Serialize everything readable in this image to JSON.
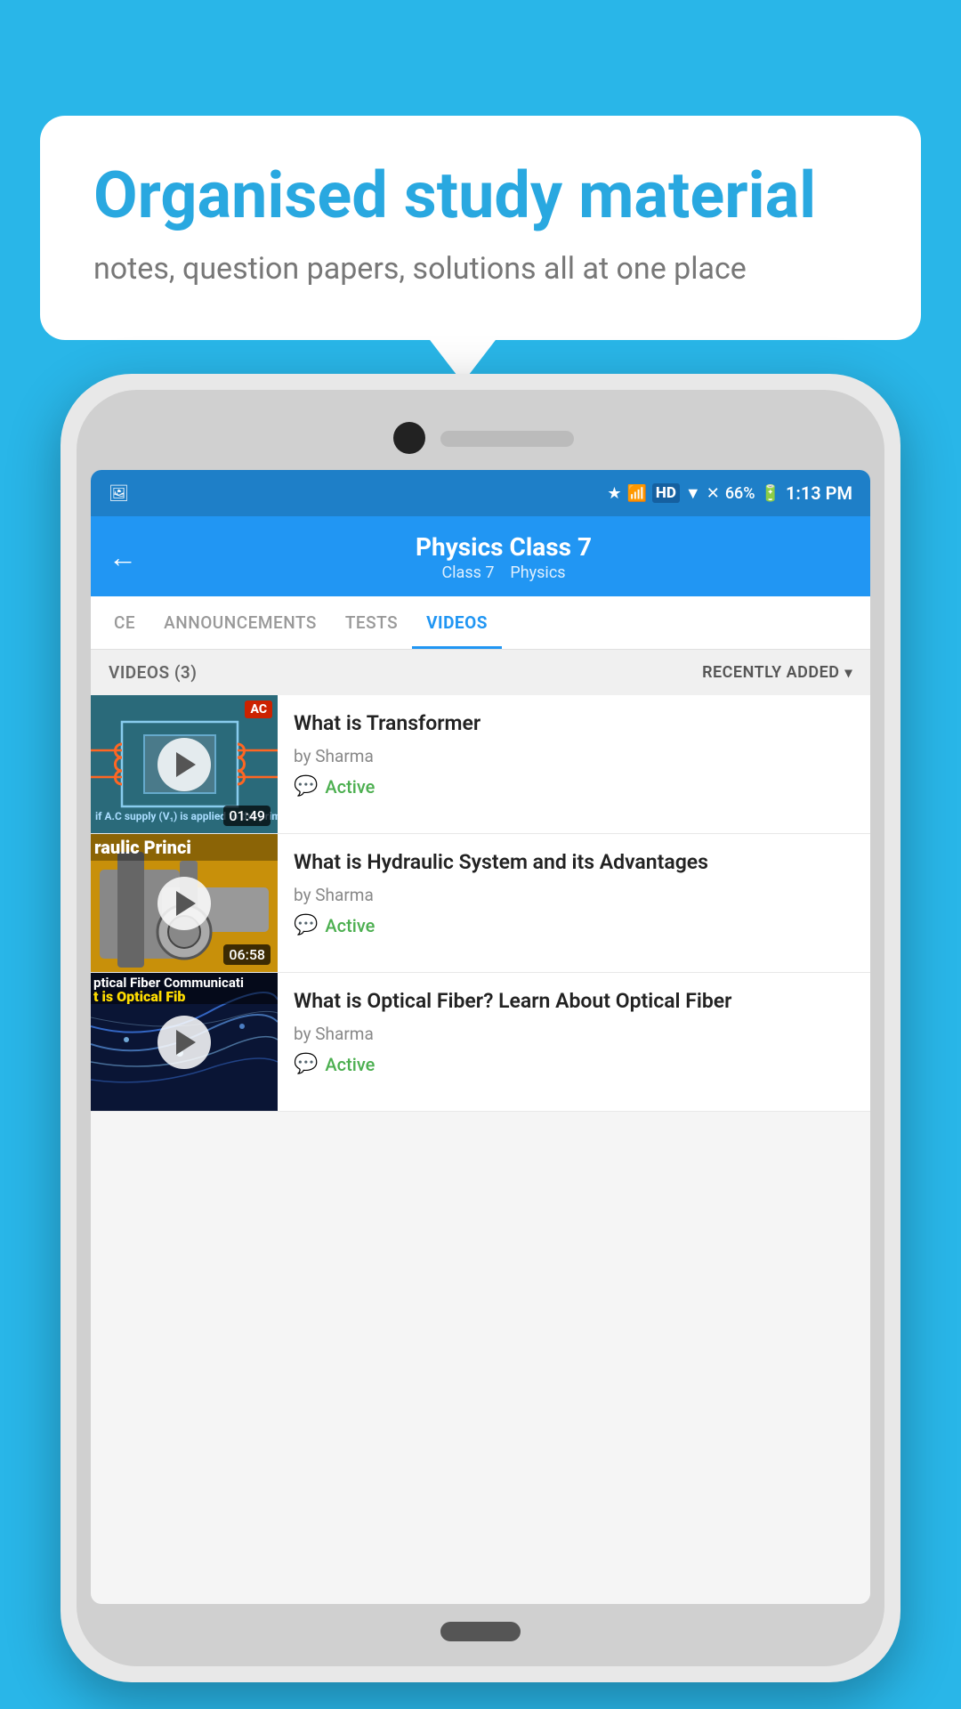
{
  "background_color": "#29b6e8",
  "speech_bubble": {
    "title": "Organised study material",
    "subtitle": "notes, question papers, solutions all at one place"
  },
  "status_bar": {
    "time": "1:13 PM",
    "battery": "66%",
    "signal_icons": "bluetooth vibrate hd wifi signal"
  },
  "app_header": {
    "back_label": "←",
    "title": "Physics Class 7",
    "subtitle_class": "Class 7",
    "subtitle_subject": "Physics"
  },
  "tabs": [
    {
      "label": "CE",
      "active": false
    },
    {
      "label": "ANNOUNCEMENTS",
      "active": false
    },
    {
      "label": "TESTS",
      "active": false
    },
    {
      "label": "VIDEOS",
      "active": true
    }
  ],
  "videos_section": {
    "count_label": "VIDEOS (3)",
    "sort_label": "RECENTLY ADDED"
  },
  "videos": [
    {
      "title": "What is  Transformer",
      "author": "by Sharma",
      "duration": "01:49",
      "status": "Active",
      "thumbnail_type": "transformer",
      "thumbnail_label": "AC"
    },
    {
      "title": "What is Hydraulic System and its Advantages",
      "author": "by Sharma",
      "duration": "06:58",
      "status": "Active",
      "thumbnail_type": "hydraulic",
      "thumbnail_label": "raulic Princi"
    },
    {
      "title": "What is Optical Fiber? Learn About Optical Fiber",
      "author": "by Sharma",
      "duration": "",
      "status": "Active",
      "thumbnail_type": "optical",
      "thumbnail_label": "ptical Fiber Communicati"
    }
  ],
  "icons": {
    "play": "▶",
    "back": "←",
    "chat": "💬",
    "chevron_down": "▾"
  }
}
